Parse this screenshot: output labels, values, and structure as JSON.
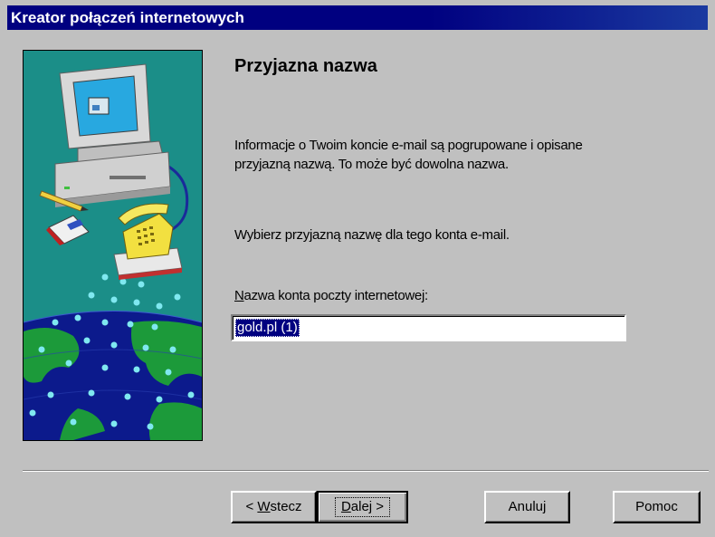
{
  "window": {
    "title": "Kreator połączeń internetowych"
  },
  "page": {
    "heading": "Przyjazna nazwa",
    "info_line1": "Informacje o Twoim koncie e-mail są pogrupowane i opisane",
    "info_line2": "przyjazną nazwą. To może być dowolna nazwa.",
    "choose_text": "Wybierz przyjazną nazwę dla tego konta e-mail.",
    "field_label_mnemonic": "N",
    "field_label_rest": "azwa konta poczty internetowej:",
    "account_name_value": "gold.pl (1)"
  },
  "buttons": {
    "back_prefix": "< ",
    "back_mnemonic": "W",
    "back_rest": "stecz",
    "next_mnemonic": "D",
    "next_rest": "alej >",
    "cancel": "Anuluj",
    "help": "Pomoc"
  },
  "illustration": {
    "icons": [
      "computer-monitor-icon",
      "telephone-modem-icon",
      "globe-icon",
      "envelope-icon",
      "pencil-icon"
    ],
    "colors": {
      "teal": "#1b8e88",
      "globe_ocean": "#0c1a8c",
      "land": "#1c9a3a",
      "dots": "#7fe8f0"
    }
  }
}
